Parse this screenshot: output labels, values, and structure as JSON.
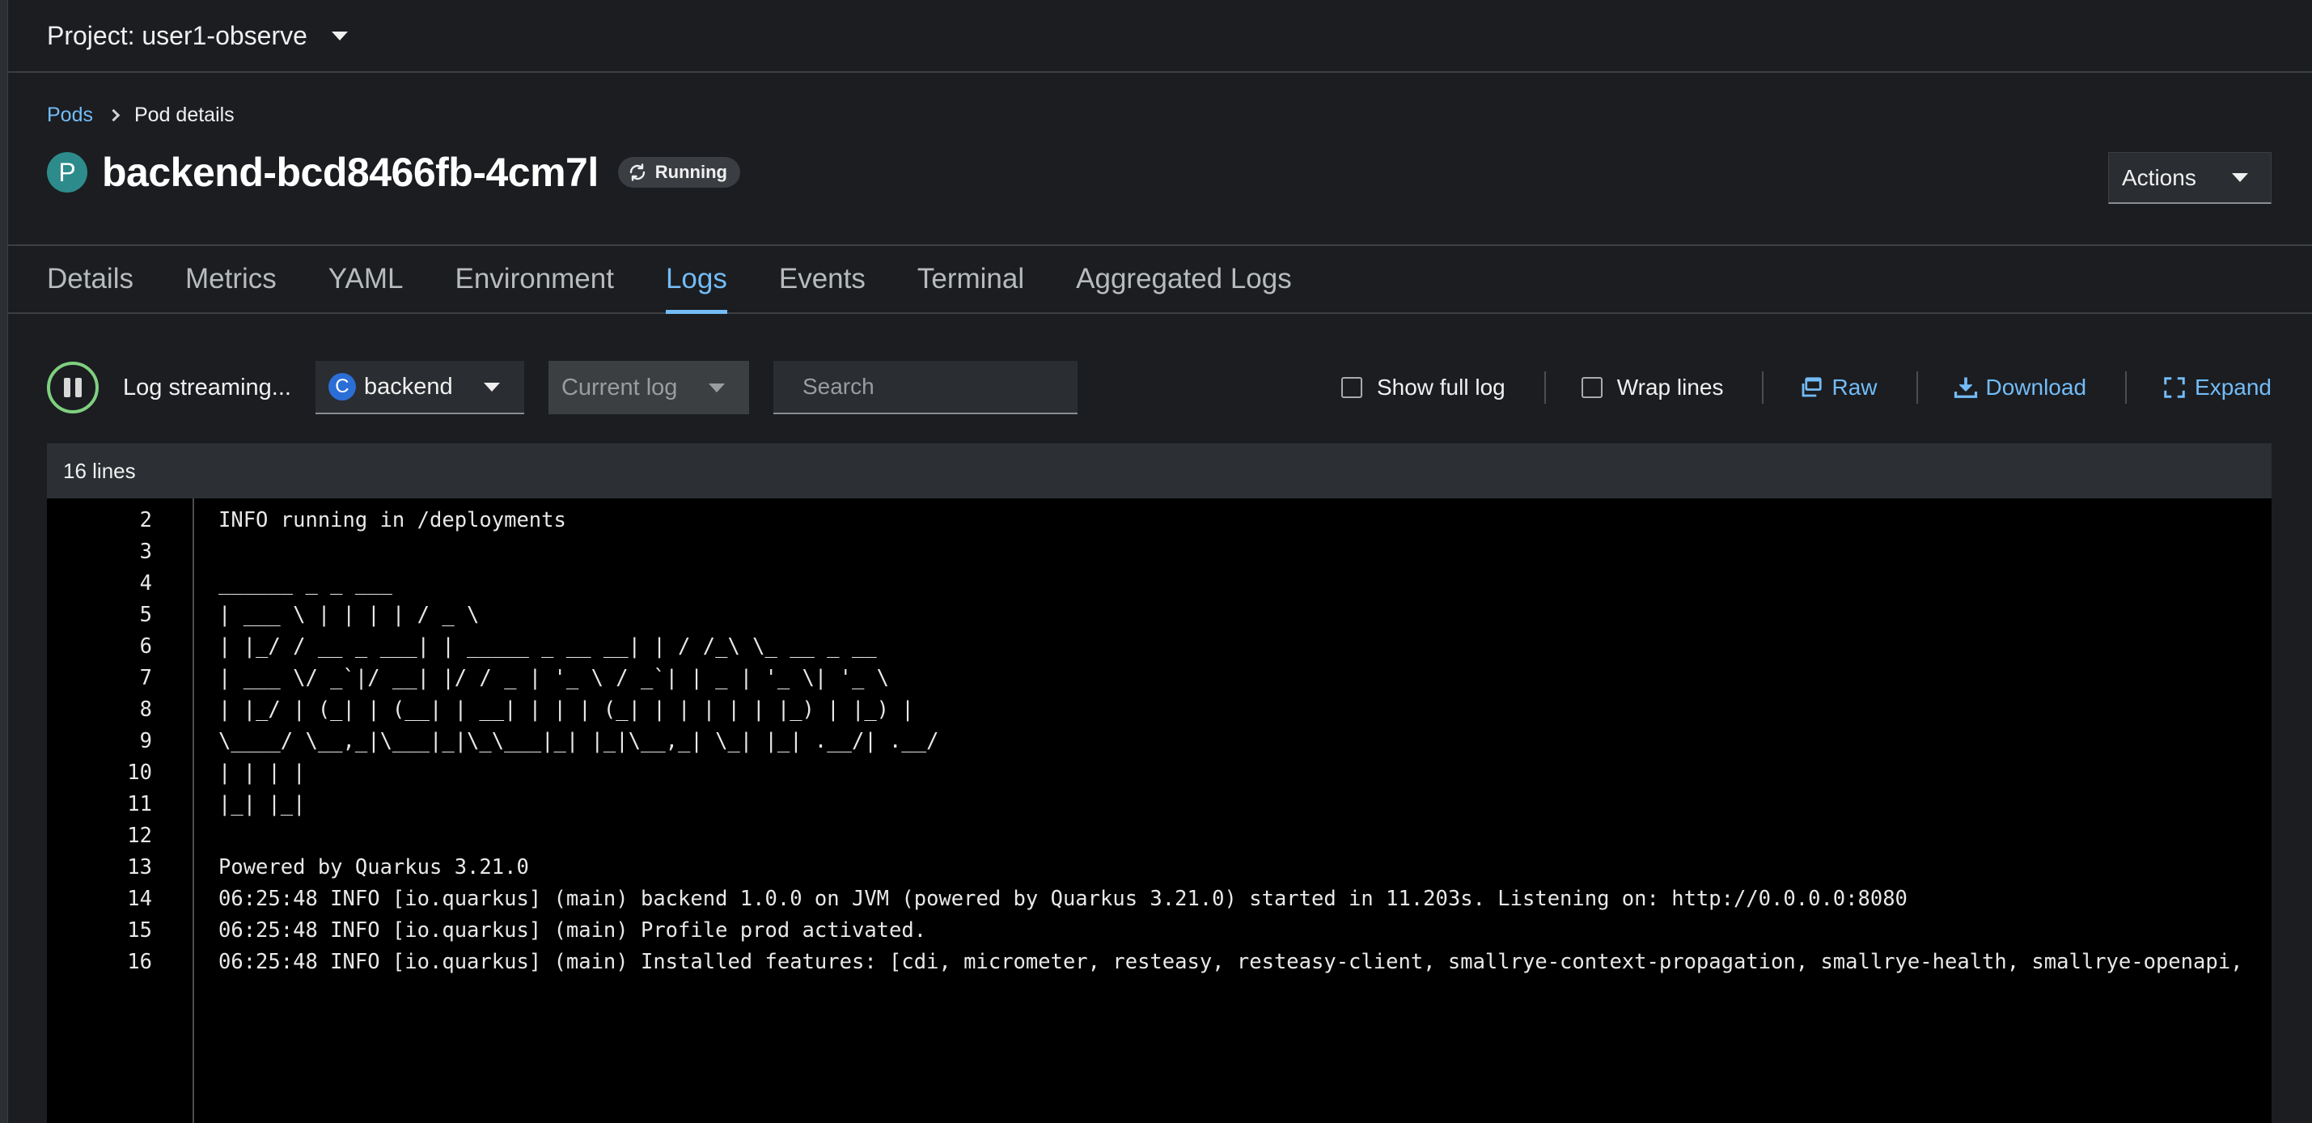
{
  "project": {
    "label": "Project: user1-observe"
  },
  "breadcrumb": {
    "parent": "Pods",
    "current": "Pod details"
  },
  "pod": {
    "badge": "P",
    "name": "backend-bcd8466fb-4cm7l",
    "status": "Running"
  },
  "actions": {
    "label": "Actions"
  },
  "tabs": [
    {
      "label": "Details"
    },
    {
      "label": "Metrics"
    },
    {
      "label": "YAML"
    },
    {
      "label": "Environment"
    },
    {
      "label": "Logs",
      "active": true
    },
    {
      "label": "Events"
    },
    {
      "label": "Terminal"
    },
    {
      "label": "Aggregated Logs"
    }
  ],
  "toolbar": {
    "streaming_label": "Log streaming...",
    "container": {
      "badge": "C",
      "value": "backend"
    },
    "log_select": "Current log",
    "search_placeholder": "Search",
    "show_full_log": "Show full log",
    "wrap_lines": "Wrap lines",
    "raw": "Raw",
    "download": "Download",
    "expand": "Expand"
  },
  "log": {
    "line_count": "16 lines",
    "lines": [
      {
        "num": "2",
        "text": "INFO running in /deployments"
      },
      {
        "num": "3",
        "text": ""
      },
      {
        "num": "4",
        "text": "______ _ _ ___"
      },
      {
        "num": "5",
        "text": "| ___ \\ | | | | / _ \\"
      },
      {
        "num": "6",
        "text": "| |_/ / __ _ ___| | _____ _ __ __| | / /_\\ \\_ __ _ __"
      },
      {
        "num": "7",
        "text": "| ___ \\/ _`|/ __| |/ / _ | '_ \\ / _`| | _ | '_ \\| '_ \\"
      },
      {
        "num": "8",
        "text": "| |_/ | (_| | (__| | __| | | | (_| | | | | | |_) | |_) |"
      },
      {
        "num": "9",
        "text": "\\____/ \\__,_|\\___|_|\\_\\___|_| |_|\\__,_| \\_| |_| .__/| .__/"
      },
      {
        "num": "10",
        "text": "| | | |"
      },
      {
        "num": "11",
        "text": "|_| |_|"
      },
      {
        "num": "12",
        "text": ""
      },
      {
        "num": "13",
        "text": "Powered by Quarkus 3.21.0"
      },
      {
        "num": "14",
        "text": "06:25:48 INFO [io.quarkus] (main) backend 1.0.0 on JVM (powered by Quarkus 3.21.0) started in 11.203s. Listening on: http://0.0.0.0:8080"
      },
      {
        "num": "15",
        "text": "06:25:48 INFO [io.quarkus] (main) Profile prod activated."
      },
      {
        "num": "16",
        "text": "06:25:48 INFO [io.quarkus] (main) Installed features: [cdi, micrometer, resteasy, resteasy-client, smallrye-context-propagation, smallrye-health, smallrye-openapi,"
      }
    ]
  }
}
